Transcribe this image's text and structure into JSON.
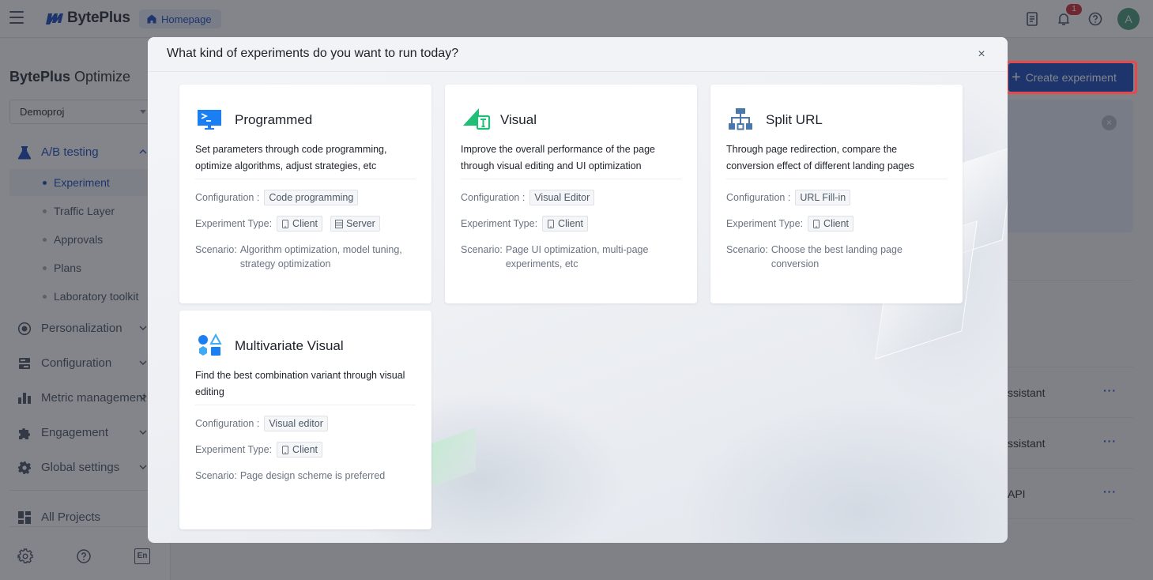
{
  "topbar": {
    "brand": "BytePlus",
    "home_chip": "Homepage",
    "notification_count": "1",
    "avatar_initial": "A"
  },
  "sidebar": {
    "product_bold": "BytePlus",
    "product_rest": " Optimize",
    "project": "Demoproj",
    "groups": [
      {
        "label": "A/B testing",
        "icon": "flask-icon",
        "expanded": true,
        "active": true
      },
      {
        "label": "Personalization",
        "icon": "target-icon",
        "expanded": false
      },
      {
        "label": "Configuration",
        "icon": "server-icon",
        "expanded": false
      },
      {
        "label": "Metric management",
        "icon": "bar-chart-icon",
        "expanded": false
      },
      {
        "label": "Engagement",
        "icon": "puzzle-icon",
        "expanded": false
      },
      {
        "label": "Global settings",
        "icon": "gear-icon",
        "expanded": false
      }
    ],
    "ab_items": [
      {
        "label": "Experiment",
        "active": true
      },
      {
        "label": "Traffic Layer"
      },
      {
        "label": "Approvals"
      },
      {
        "label": "Plans"
      },
      {
        "label": "Laboratory toolkit"
      }
    ],
    "all_projects": "All Projects",
    "footer_lang": "En"
  },
  "page": {
    "create_button": "Create experiment",
    "rows": [
      "ssistant",
      "ssistant",
      "API"
    ],
    "more": "···",
    "accent": "#1e4ebd"
  },
  "modal": {
    "title": "What kind of experiments do you want to run today?",
    "close": "×",
    "labels": {
      "configuration": "Configuration :",
      "experiment_type": "Experiment Type:",
      "scenario": "Scenario:"
    },
    "cards": [
      {
        "title": "Programmed",
        "icon": "terminal-monitor-icon",
        "description": "Set parameters through code programming, optimize algorithms, adjust strategies, etc",
        "configuration": "Code programming",
        "types": [
          "Client",
          "Server"
        ],
        "scenario": "Algorithm optimization, model tuning, strategy optimization"
      },
      {
        "title": "Visual",
        "icon": "visual-editor-icon",
        "description": "Improve the overall performance of the page through visual editing and UI optimization",
        "configuration": "Visual Editor",
        "types": [
          "Client"
        ],
        "scenario": "Page UI optimization, multi-page experiments, etc"
      },
      {
        "title": "Split URL",
        "icon": "sitemap-icon",
        "description": "Through page redirection, compare the conversion effect of different landing pages",
        "configuration": "URL Fill-in",
        "types": [
          "Client"
        ],
        "scenario": "Choose the best landing page conversion"
      },
      {
        "title": "Multivariate Visual",
        "icon": "shapes-icon",
        "description": "Find the best combination variant through visual editing",
        "configuration": "Visual editor",
        "types": [
          "Client"
        ],
        "scenario": "Page design scheme is preferred"
      }
    ]
  }
}
